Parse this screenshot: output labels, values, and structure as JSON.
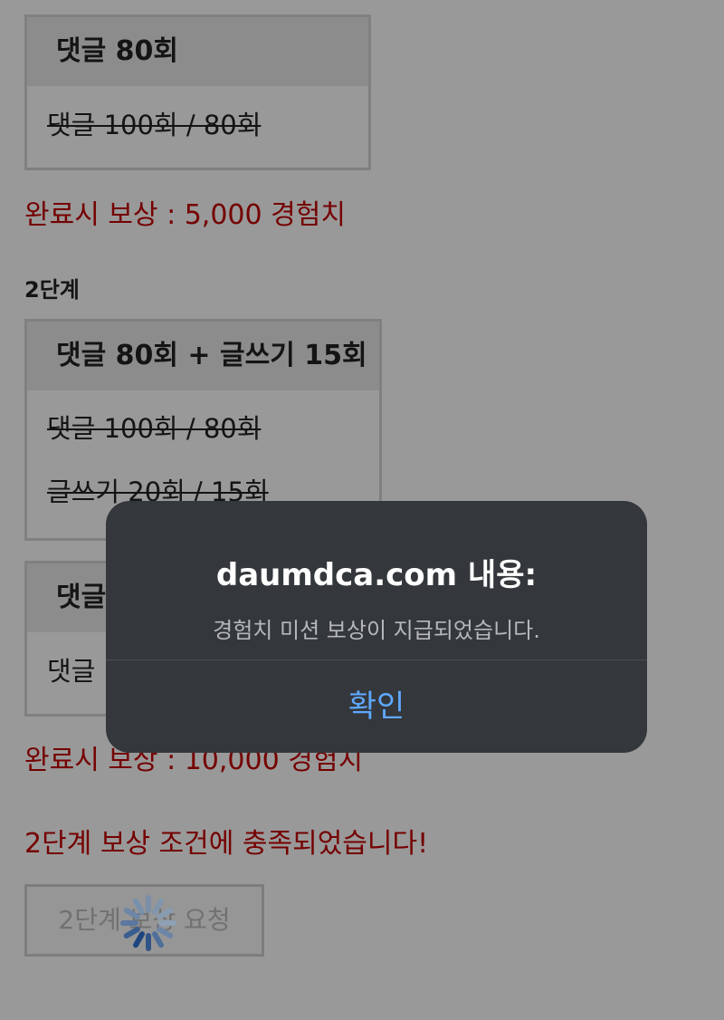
{
  "missions": {
    "box1": {
      "header": "댓글 80회",
      "rows": [
        "댓글 100회 / 80회"
      ]
    },
    "reward1": "완료시 보상 : 5,000 경험치",
    "stage2_label": "2단계",
    "box2": {
      "header": "댓글 80회 + 글쓰기 15회",
      "rows": [
        "댓글 100회 / 80회",
        "글쓰기 20회 / 15회"
      ]
    },
    "box3": {
      "header": "댓글",
      "rows": [
        "댓글"
      ]
    },
    "reward2": "완료시 보상 : 10,000 경험치",
    "stage2_complete": "2단계 보상 조건에 충족되었습니다!",
    "claim_button": "2단계 보상 요청"
  },
  "colors": {
    "reward_red": "#c40000",
    "dialog_bg": "#34373b",
    "dialog_button": "#5ea8ff"
  },
  "dialog": {
    "title": "daumdca.com 내용:",
    "message": "경험치 미션 보상이 지급되었습니다.",
    "confirm_label": "확인"
  },
  "loading": {
    "icon": "spinner-icon"
  }
}
